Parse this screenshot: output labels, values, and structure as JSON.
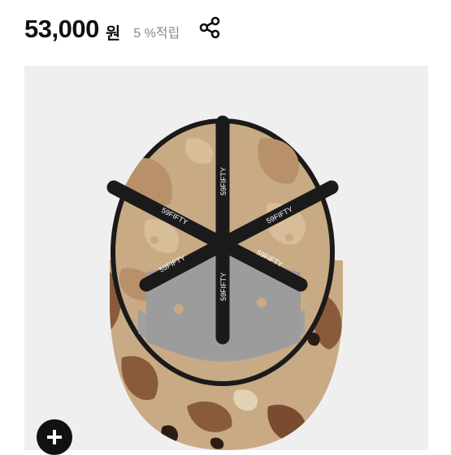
{
  "product": {
    "price": "53,000",
    "currency": "원",
    "reward": "5 %적립"
  },
  "cap_image": {
    "brand_label": "59FIFTY"
  },
  "icons": {
    "share": "share-icon",
    "add": "plus-icon"
  },
  "colors": {
    "price_text": "#111111",
    "reward_text": "#8a8a8a",
    "image_bg": "#efefef",
    "camo_tan": "#c8aa85",
    "camo_brown": "#8a5a3c",
    "tape_black": "#1a1a1a"
  }
}
